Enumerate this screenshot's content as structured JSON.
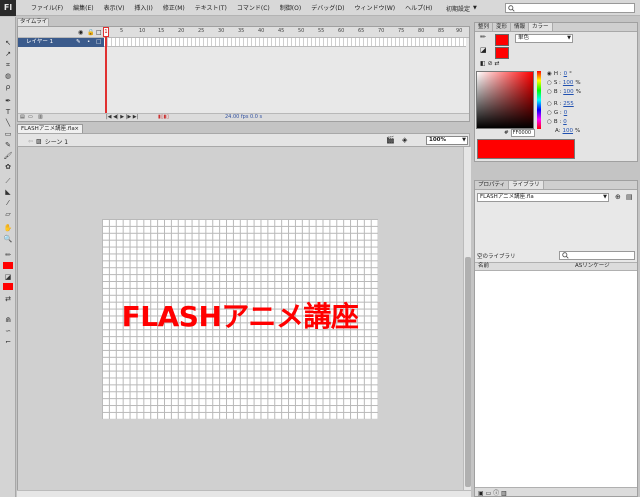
{
  "app": {
    "logo": "Fl"
  },
  "menu": [
    "ファイル(F)",
    "編集(E)",
    "表示(V)",
    "挿入(I)",
    "修正(M)",
    "テキスト(T)",
    "コマンド(C)",
    "制御(O)",
    "デバッグ(D)",
    "ウィンドウ(W)",
    "ヘルプ(H)"
  ],
  "workspace": "初期設定",
  "search": {
    "placeholder": ""
  },
  "timeline": {
    "tab_label": "タイムライン",
    "layer_name": "レイヤー 1",
    "ruler": [
      "1",
      "5",
      "10",
      "15",
      "20",
      "25",
      "30",
      "35",
      "40",
      "45",
      "50",
      "55",
      "60",
      "65",
      "70",
      "75",
      "80",
      "85",
      "90"
    ],
    "current_frame": "1",
    "fps": "24.00 fps",
    "time": "0.0 s"
  },
  "document": {
    "tab_label": "FLASHアニメ講座.fla",
    "close": "×",
    "scene": "シーン 1",
    "zoom": "100%",
    "stage_text": "FLASHアニメ講座",
    "stage_text_color": "#ff0000"
  },
  "color_panel": {
    "tabs": [
      "整列",
      "変形",
      "情報",
      "カラー"
    ],
    "active_tab": "カラー",
    "type": "単色",
    "fields": [
      {
        "label": "H :",
        "value": "0",
        "unit": "°"
      },
      {
        "label": "S :",
        "value": "100",
        "unit": "%"
      },
      {
        "label": "B :",
        "value": "100",
        "unit": "%"
      },
      {
        "label": "R :",
        "value": "255",
        "unit": ""
      },
      {
        "label": "G :",
        "value": "0",
        "unit": ""
      },
      {
        "label": "B :",
        "value": "0",
        "unit": ""
      },
      {
        "label": "A:",
        "value": "100",
        "unit": "%"
      }
    ],
    "hex_label": "#",
    "hex": "FF0000",
    "color": "#ff0000"
  },
  "library": {
    "tabs": [
      "プロパティ",
      "ライブラリ"
    ],
    "active_tab": "ライブラリ",
    "document": "FLASHアニメ講座.fla",
    "count": "空のライブラリ",
    "col_name": "名前",
    "col_linkage": "ASリンケージ"
  }
}
